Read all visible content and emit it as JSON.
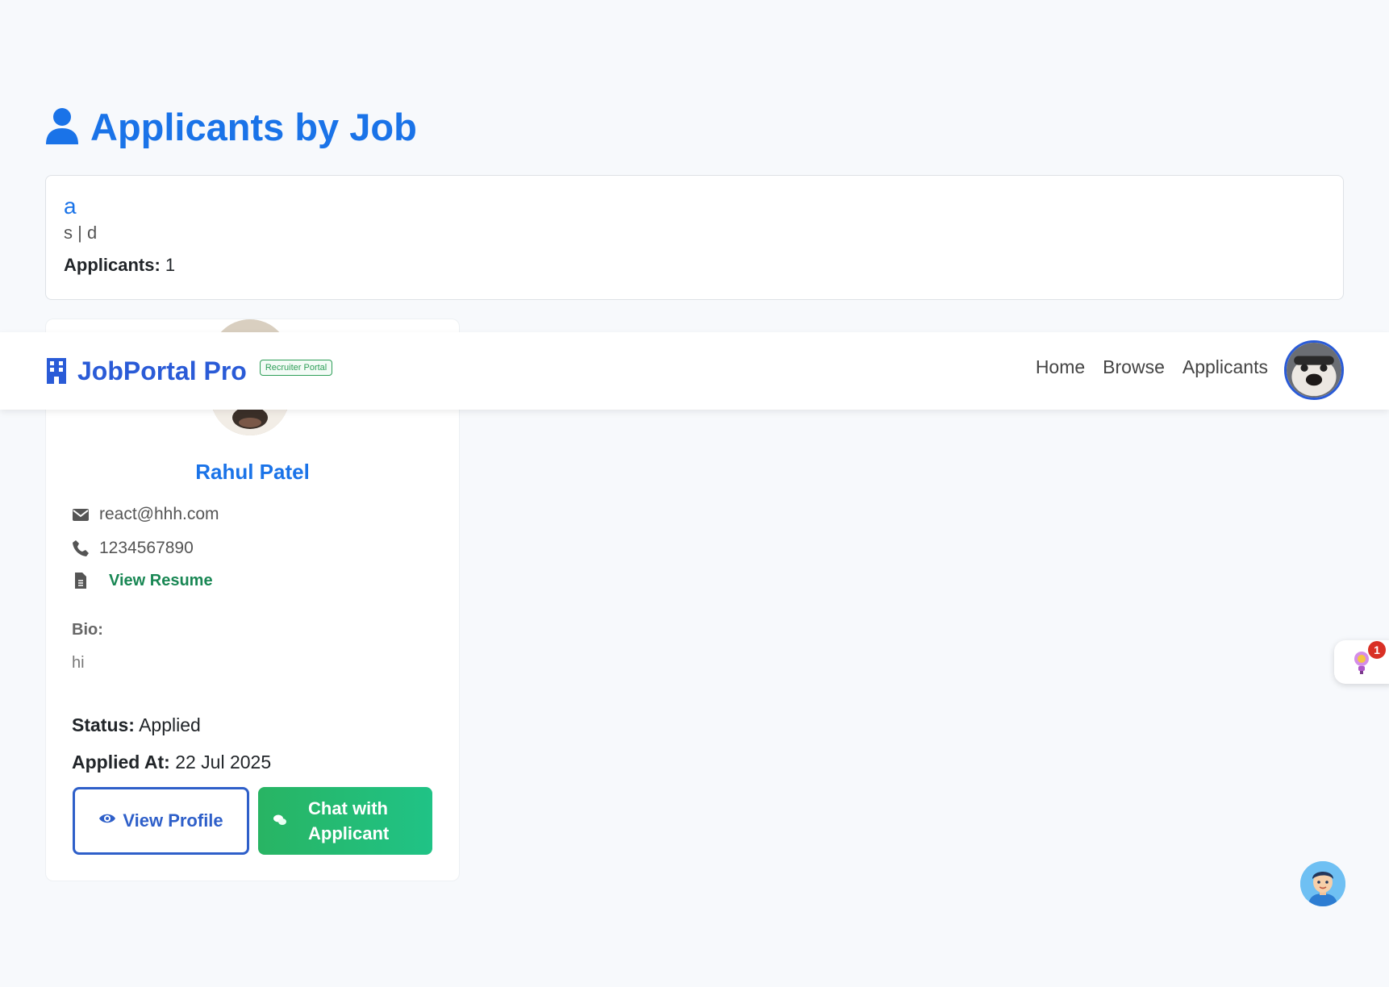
{
  "page": {
    "title": "Applicants by Job"
  },
  "job": {
    "title": "a",
    "meta": "s | d",
    "applicants_label": "Applicants:",
    "applicants_count": "1"
  },
  "applicant": {
    "name": "Rahul Patel",
    "email": "react@hhh.com",
    "phone": "1234567890",
    "resume_link": "View Resume",
    "bio_label": "Bio:",
    "bio": "hi",
    "status_label": "Status:",
    "status": "Applied",
    "applied_label": "Applied At:",
    "applied_at": "22 Jul 2025",
    "view_profile_button": "View Profile",
    "chat_button": "Chat with Applicant"
  },
  "navbar": {
    "brand": "JobPortal Pro",
    "badge": "Recruiter Portal",
    "links": [
      "Home",
      "Browse",
      "Applicants"
    ]
  },
  "widgets": {
    "notification_count": "1"
  },
  "colors": {
    "primary": "#1a73e8",
    "brand": "#2a5bd7",
    "success": "#198754",
    "chat_button": "#28b463",
    "badge": "#d93025",
    "background": "#f7f9fc"
  },
  "icons": [
    "user-icon",
    "building-icon",
    "envelope-icon",
    "phone-icon",
    "file-icon",
    "eye-icon",
    "chat-icon",
    "lightbulb-icon"
  ]
}
